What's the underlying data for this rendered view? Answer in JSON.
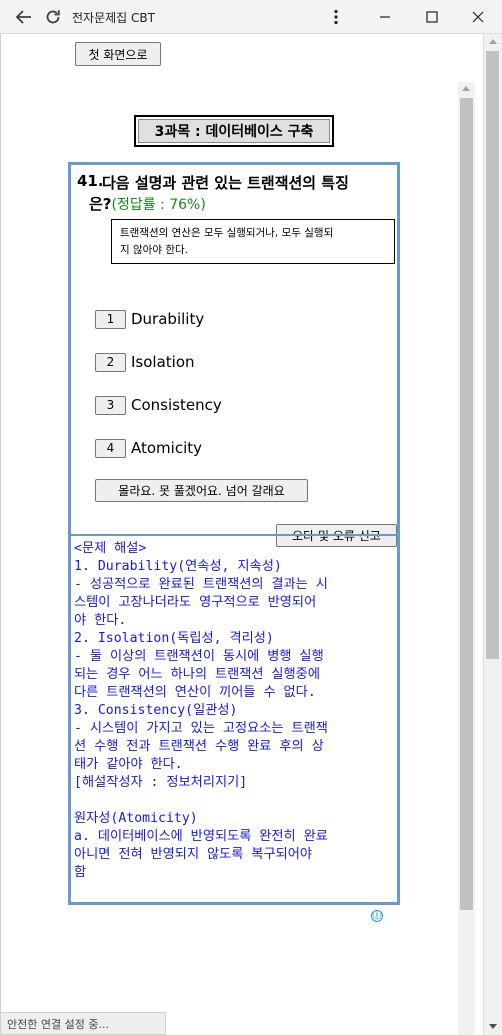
{
  "window": {
    "title": "전자문제집 CBT",
    "icons": [
      "back-arrow-icon",
      "reload-icon",
      "more-vert-icon",
      "minimize-icon",
      "maximize-icon",
      "close-icon"
    ]
  },
  "page": {
    "home_button": "첫 화면으로",
    "subject": "3과목 : 데이터베이스 구축",
    "question": {
      "number": "41.",
      "line1": "다음 설명과 관련 있는 트랜잭션의 특징",
      "line2": "은?",
      "rate": "(정답률 : 76%)",
      "stem_line1": "트랜잭션의 연산은 모두 실행되거나, 모두 실행되",
      "stem_line2": "지 않아야 한다.",
      "choices": [
        {
          "num": "1",
          "text": "Durability"
        },
        {
          "num": "2",
          "text": "Isolation"
        },
        {
          "num": "3",
          "text": "Consistency"
        },
        {
          "num": "4",
          "text": "Atomicity"
        }
      ],
      "skip_button": "몰라요. 못 풀겠어요. 넘어 갈래요",
      "report_button": "오타 및 오류 신고"
    },
    "explanation": {
      "lines": [
        "<문제 해설>",
        "1. Durability(연속성, 지속성)",
        "- 성공적으로 완료된 트랜잭션의 결과는 시",
        "스템이 고장나더라도 영구적으로 반영되어",
        "야 한다.",
        "2. Isolation(독립성, 격리성)",
        "- 둘 이상의 트랜잭션이 동시에 병행 실행",
        "되는 경우 어느 하나의 트랜잭션 실행중에",
        "다른 트랜잭션의 연산이 끼어들 수 없다.",
        "3. Consistency(일관성)",
        "- 시스템이 가지고 있는 고정요소는 트랜잭",
        "션 수행 전과 트랜잭션 수행 완료 후의 상",
        "태가 같아야 한다.",
        "[해설작성자 : 정보처리지기]",
        "",
        "원자성(Atomicity)",
        "a. 데이터베이스에 반영되도록 완전히 완료",
        "아니면 전혀 반영되지 않도록 복구되어야",
        "함"
      ]
    },
    "info_icon": "ⓘ",
    "status_text": "안전한 연결 설정 중..."
  },
  "colors": {
    "question_border": "#6b9ac9",
    "rate": "#138a13",
    "explanation_text": "#1a1ad6"
  }
}
